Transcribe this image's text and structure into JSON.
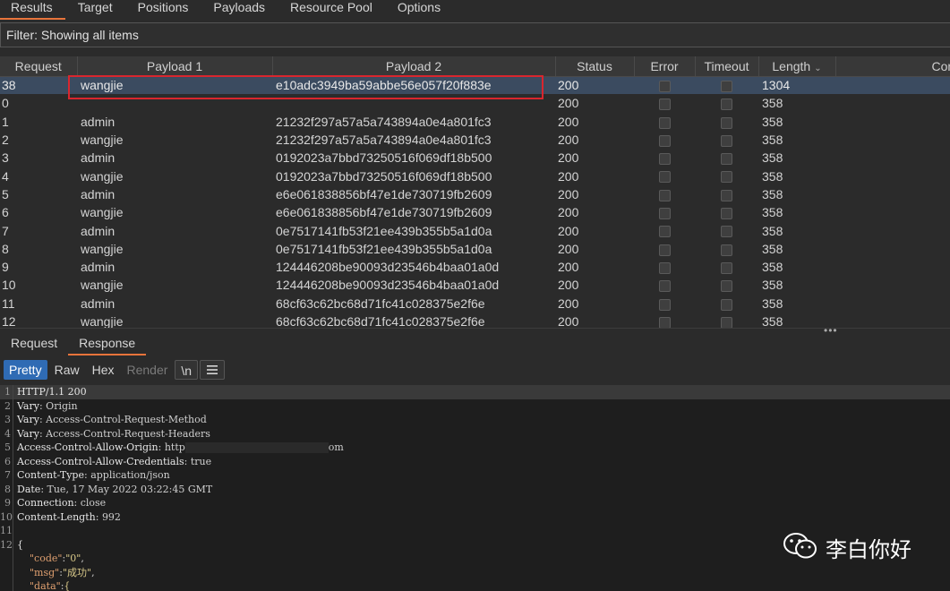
{
  "top_tabs": [
    "Results",
    "Target",
    "Positions",
    "Payloads",
    "Resource Pool",
    "Options"
  ],
  "filter": "Filter: Showing all items",
  "table": {
    "columns": [
      "Request",
      "Payload 1",
      "Payload 2",
      "Status",
      "Error",
      "Timeout",
      "Length",
      "Comme"
    ],
    "rows": [
      {
        "req": "38",
        "p1": "wangjie",
        "p2": "e10adc3949ba59abbe56e057f20f883e",
        "status": "200",
        "len": "1304"
      },
      {
        "req": "0",
        "p1": "",
        "p2": "",
        "status": "200",
        "len": "358"
      },
      {
        "req": "1",
        "p1": "admin",
        "p2": "21232f297a57a5a743894a0e4a801fc3",
        "status": "200",
        "len": "358"
      },
      {
        "req": "2",
        "p1": "wangjie",
        "p2": "21232f297a57a5a743894a0e4a801fc3",
        "status": "200",
        "len": "358"
      },
      {
        "req": "3",
        "p1": "admin",
        "p2": "0192023a7bbd73250516f069df18b500",
        "status": "200",
        "len": "358"
      },
      {
        "req": "4",
        "p1": "wangjie",
        "p2": "0192023a7bbd73250516f069df18b500",
        "status": "200",
        "len": "358"
      },
      {
        "req": "5",
        "p1": "admin",
        "p2": "e6e061838856bf47e1de730719fb2609",
        "status": "200",
        "len": "358"
      },
      {
        "req": "6",
        "p1": "wangjie",
        "p2": "e6e061838856bf47e1de730719fb2609",
        "status": "200",
        "len": "358"
      },
      {
        "req": "7",
        "p1": "admin",
        "p2": "0e7517141fb53f21ee439b355b5a1d0a",
        "status": "200",
        "len": "358"
      },
      {
        "req": "8",
        "p1": "wangjie",
        "p2": "0e7517141fb53f21ee439b355b5a1d0a",
        "status": "200",
        "len": "358"
      },
      {
        "req": "9",
        "p1": "admin",
        "p2": "124446208be90093d23546b4baa01a0d",
        "status": "200",
        "len": "358"
      },
      {
        "req": "10",
        "p1": "wangjie",
        "p2": "124446208be90093d23546b4baa01a0d",
        "status": "200",
        "len": "358"
      },
      {
        "req": "11",
        "p1": "admin",
        "p2": "68cf63c62bc68d71fc41c028375e2f6e",
        "status": "200",
        "len": "358"
      },
      {
        "req": "12",
        "p1": "wangjie",
        "p2": "68cf63c62bc68d71fc41c028375e2f6e",
        "status": "200",
        "len": "358"
      }
    ]
  },
  "sub_tabs": [
    "Request",
    "Response"
  ],
  "toolbar": {
    "pretty": "Pretty",
    "raw": "Raw",
    "hex": "Hex",
    "render": "Render",
    "newline": "\\n",
    "menu_icon": "hamburger-icon"
  },
  "response": {
    "lines": [
      {
        "n": "1",
        "name": "HTTP/1.1 200",
        "sep": "",
        "value": ""
      },
      {
        "n": "2",
        "name": "Vary",
        "sep": ": ",
        "value": "Origin"
      },
      {
        "n": "3",
        "name": "Vary",
        "sep": ": ",
        "value": "Access-Control-Request-Method"
      },
      {
        "n": "4",
        "name": "Vary",
        "sep": ": ",
        "value": "Access-Control-Request-Headers"
      },
      {
        "n": "5",
        "name": "Access-Control-Allow-Origin",
        "sep": ": ",
        "value": "http",
        "value_tail": "om"
      },
      {
        "n": "6",
        "name": "Access-Control-Allow-Credentials",
        "sep": ": ",
        "value": "true"
      },
      {
        "n": "7",
        "name": "Content-Type",
        "sep": ": ",
        "value": "application/json"
      },
      {
        "n": "8",
        "name": "Date",
        "sep": ": ",
        "value": "Tue, 17 May 2022 03:22:45 GMT"
      },
      {
        "n": "9",
        "name": "Connection",
        "sep": ": ",
        "value": "close"
      },
      {
        "n": "10",
        "name": "Content-Length",
        "sep": ": ",
        "value": "992"
      },
      {
        "n": "11",
        "name": "",
        "sep": "",
        "value": ""
      },
      {
        "n": "12",
        "name": "{",
        "sep": "",
        "value": ""
      }
    ],
    "json_lines": [
      {
        "key": "\"code\"",
        "colon": ":",
        "val": "\"0\"",
        "tail": ","
      },
      {
        "key": "\"msg\"",
        "colon": ":",
        "val": "\"成功\"",
        "tail": ","
      },
      {
        "key": "\"data\"",
        "colon": ":",
        "val": "{",
        "tail": ""
      }
    ]
  },
  "watermark": {
    "text": "李白你好",
    "icon": "wechat-icon"
  },
  "colors": {
    "accent_tab": "#e8743b",
    "selected_row": "#3b4b60",
    "highlight_box": "#d9262e",
    "pretty_active": "#2f6bb4"
  }
}
